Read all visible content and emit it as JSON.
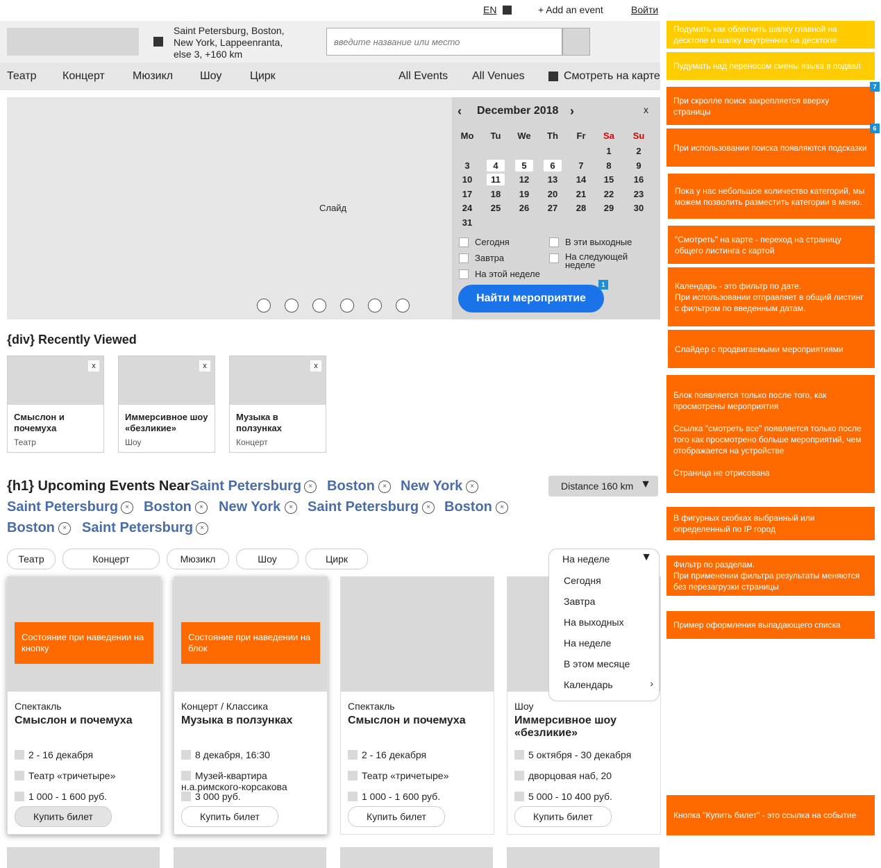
{
  "topbar": {
    "lang": "EN",
    "add_event": "+ Add an event",
    "login": "Войти"
  },
  "header": {
    "location": "Saint Petersburg, Boston, New York, Lappeenranta, else 3, +160 km",
    "search_placeholder": "введите название или место"
  },
  "nav": {
    "categories": [
      "Театр",
      "Концерт",
      "Мюзикл",
      "Шоу",
      "Цирк"
    ],
    "all_events": "All Events",
    "all_venues": "All Venues",
    "map": "Смотреть на карте"
  },
  "slider": {
    "label": "Слайд",
    "dots": 6
  },
  "calendar": {
    "prev": "‹",
    "next": "›",
    "close": "x",
    "month": "December 2018",
    "weekdays": [
      "Mo",
      "Tu",
      "We",
      "Th",
      "Fr",
      "Sa",
      "Su"
    ],
    "weekend_color": "#e00000",
    "weeks": [
      [
        "",
        "",
        "",
        "",
        "",
        "1",
        "2"
      ],
      [
        "3",
        "4",
        "5",
        "6",
        "7",
        "8",
        "9"
      ],
      [
        "10",
        "11",
        "12",
        "13",
        "14",
        "15",
        "16"
      ],
      [
        "17",
        "18",
        "19",
        "20",
        "21",
        "22",
        "23"
      ],
      [
        "24",
        "25",
        "26",
        "27",
        "28",
        "29",
        "30"
      ],
      [
        "31",
        "",
        "",
        "",
        "",
        "",
        ""
      ]
    ],
    "highlighted": [
      "4",
      "5",
      "6",
      "11"
    ],
    "options": {
      "today": "Сегодня",
      "tomorrow": "Завтра",
      "this_week": "На этой неделе",
      "weekend": "В эти выходные",
      "next_week": "На следующей неделе"
    },
    "find_button": "Найти мероприятие",
    "badge": "1"
  },
  "recently_viewed": {
    "title": "{div} Recently Viewed",
    "items": [
      {
        "title": "Смыслон и почемуха",
        "category": "Театр"
      },
      {
        "title": "Иммерсивное шоу «безликие»",
        "category": "Шоу"
      },
      {
        "title": "Музыка в ползунках",
        "category": "Концерт"
      }
    ],
    "close": "x"
  },
  "upcoming": {
    "title": "{h1} Upcoming Events Near",
    "cities_line1": [
      "Saint Petersburg",
      "Boston",
      "New York"
    ],
    "cities_line2": [
      "Saint Petersburg",
      "Boston",
      "New York",
      "Saint Petersburg",
      "Boston"
    ],
    "cities_line3": [
      "Boston",
      "Saint Petersburg"
    ],
    "remove": "×",
    "distance": "Distance 160 km",
    "filters": [
      "Театр",
      "Концерт",
      "Мюзикл",
      "Шоу",
      "Цирк"
    ],
    "period": {
      "selected": "На неделе",
      "options": [
        "Сегодня",
        "Завтра",
        "На выходных",
        "На неделе",
        "В этом месяце",
        "Календарь"
      ],
      "calendar_arrow": "›"
    }
  },
  "events": [
    {
      "hover_text": "Состояние при наведении на кнопку",
      "type": "Спектакль",
      "name": "Смыслон и почемуха",
      "date": "2 - 16 декабря",
      "venue": "Театр «тричетыре»",
      "price": "1 000 - 1 600 руб.",
      "buy": "Купить билет"
    },
    {
      "hover_text": "Состояние при наведении на блок",
      "type": "Концерт / Классика",
      "name": "Музыка в ползунках",
      "date": "8 декабря, 16:30",
      "venue": "Музей-квартира н.а.римского-корсакова",
      "price": "3 000 руб.",
      "buy": "Купить билет"
    },
    {
      "hover_text": "",
      "type": "Спектакль",
      "name": "Смыслон и почемуха",
      "date": "2 - 16 декабря",
      "venue": "Театр «тричетыре»",
      "price": "1 000 - 1 600 руб.",
      "buy": "Купить билет"
    },
    {
      "hover_text": "",
      "type": "Шоу",
      "name": "Иммерсивное шоу «безликие»",
      "date": "5 октября - 30 декабря",
      "venue": "дворцовая наб, 20",
      "price": "5 000 - 10 400 руб.",
      "buy": "Купить билет"
    }
  ],
  "notes": [
    {
      "text": "Подумать как облегчить шапку главной на десктопе и шапку внутренних на десктопе",
      "color": "#ffcc00"
    },
    {
      "text": "Пудумать над переносом смены языка в подвал",
      "color": "#ffcc00"
    },
    {
      "text": "При скролле поиск закрепляется вверху страницы",
      "color": "#ff6a00",
      "badge": "7"
    },
    {
      "text": "При использовании поиска появляются подсказки",
      "color": "#ff6a00",
      "badge": "6"
    },
    {
      "text": "Пока у нас небольшое количество категорий, мы можем позволить разместить категории в меню.",
      "color": "#ff6a00"
    },
    {
      "text": "\"Смотреть\" на карте - переход на страницу общего листинга с картой",
      "color": "#ff6a00"
    },
    {
      "text": "Календарь - это фильтр по дате.\nПри использовании отправляет в общий листинг с фильтром по введенным датам.",
      "color": "#ff6a00"
    },
    {
      "text": "Слайдер с продвигаемыми мероприятиями",
      "color": "#ff6a00"
    },
    {
      "text": "Блок появляется только после того, как просмотрены мероприятия\n\nСсылка \"смотреть все\" появляется только после того как просмотрено больше мероприятий, чем отображается на устройстве\n\nСтраница не отрисована",
      "color": "#ff6a00"
    },
    {
      "text": "В фигурных скобках выбранный или определенный по IP город",
      "color": "#ff6a00"
    },
    {
      "text": "Фильтр по разделам.\nПри применении фильтра результаты меняются без перезагрузки страницы",
      "color": "#ff6a00"
    },
    {
      "text": "Пример оформления выпадающего списка",
      "color": "#ff6a00"
    },
    {
      "text": "Кнопка \"Купить билет\" - это ссылка на событие",
      "color": "#ff6a00"
    }
  ]
}
